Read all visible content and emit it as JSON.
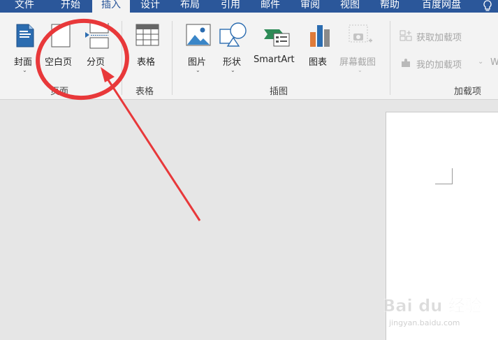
{
  "tabs": [
    "文件",
    "开始",
    "插入",
    "设计",
    "布局",
    "引用",
    "邮件",
    "审阅",
    "视图",
    "帮助",
    "百度网盘"
  ],
  "ribbon": {
    "cover": "封面",
    "blank_page": "空白页",
    "page_break": "分页",
    "table": "表格",
    "picture": "图片",
    "shapes": "形状",
    "smartart": "SmartArt",
    "chart": "图表",
    "screenshot": "屏幕截图",
    "get_addins": "获取加载项",
    "my_addins": "我的加载项",
    "more_truncated": "W"
  },
  "groups": {
    "pages": "页面",
    "tables": "表格",
    "illustrations": "插图",
    "addins": "加载项"
  },
  "watermark": {
    "logo": "Bai du 经验",
    "url": "jingyan.baidu.com"
  },
  "annotation_color": "#e8383a",
  "accent": "#2b579a"
}
